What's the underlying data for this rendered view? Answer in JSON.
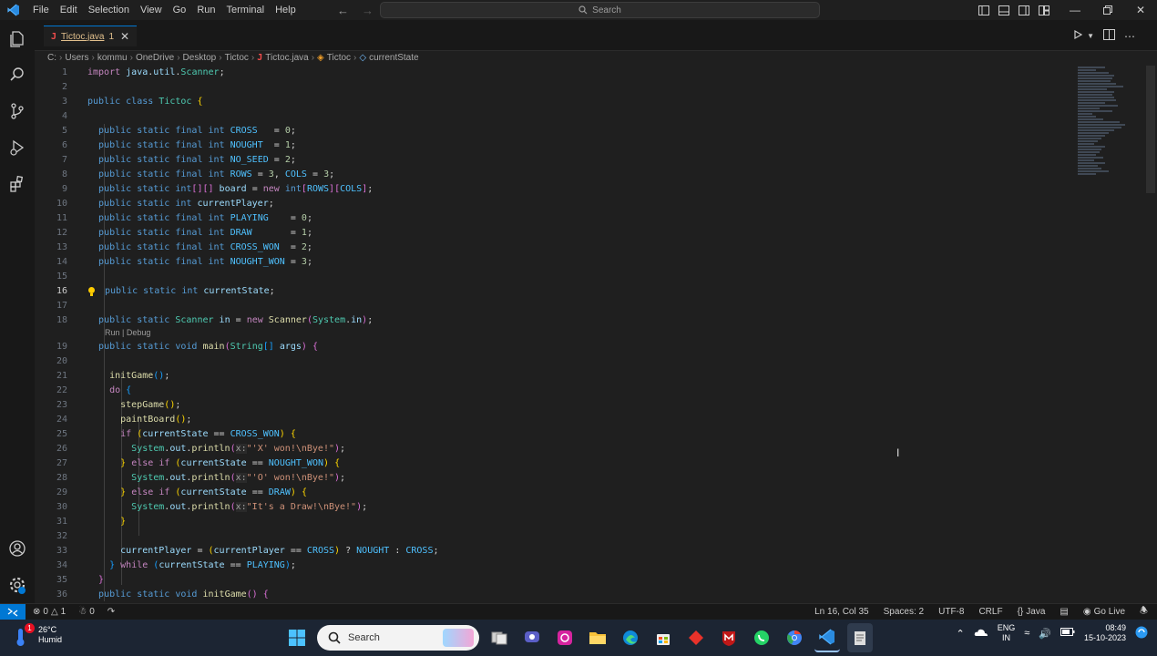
{
  "titlebar": {
    "menu": [
      "File",
      "Edit",
      "Selection",
      "View",
      "Go",
      "Run",
      "Terminal",
      "Help"
    ],
    "search_placeholder": "Search"
  },
  "tab": {
    "name": "Tictoc.java",
    "count": "1",
    "lang_letter": "J"
  },
  "breadcrumb": {
    "items": [
      "C:",
      "Users",
      "kommu",
      "OneDrive",
      "Desktop",
      "Tictoc"
    ],
    "file": "Tictoc.java",
    "class": "Tictoc",
    "field": "currentState"
  },
  "editor": {
    "codelens": "Run | Debug",
    "current_line": "16"
  },
  "statusbar": {
    "errors": "0",
    "warnings": "1",
    "ports": "0",
    "cursor": "Ln 16, Col 35",
    "spaces": "Spaces: 2",
    "encoding": "UTF-8",
    "eol": "CRLF",
    "language": "Java",
    "golive": "Go Live"
  },
  "taskbar": {
    "temp": "26°C",
    "condition": "Humid",
    "search": "Search",
    "lang_top": "ENG",
    "lang_bottom": "IN",
    "time": "08:49",
    "date": "15-10-2023",
    "notification_count": "1"
  },
  "colors": {
    "accent": "#0078d4",
    "error_file": "#e2c08d",
    "editor_bg": "#1f1f1f"
  }
}
